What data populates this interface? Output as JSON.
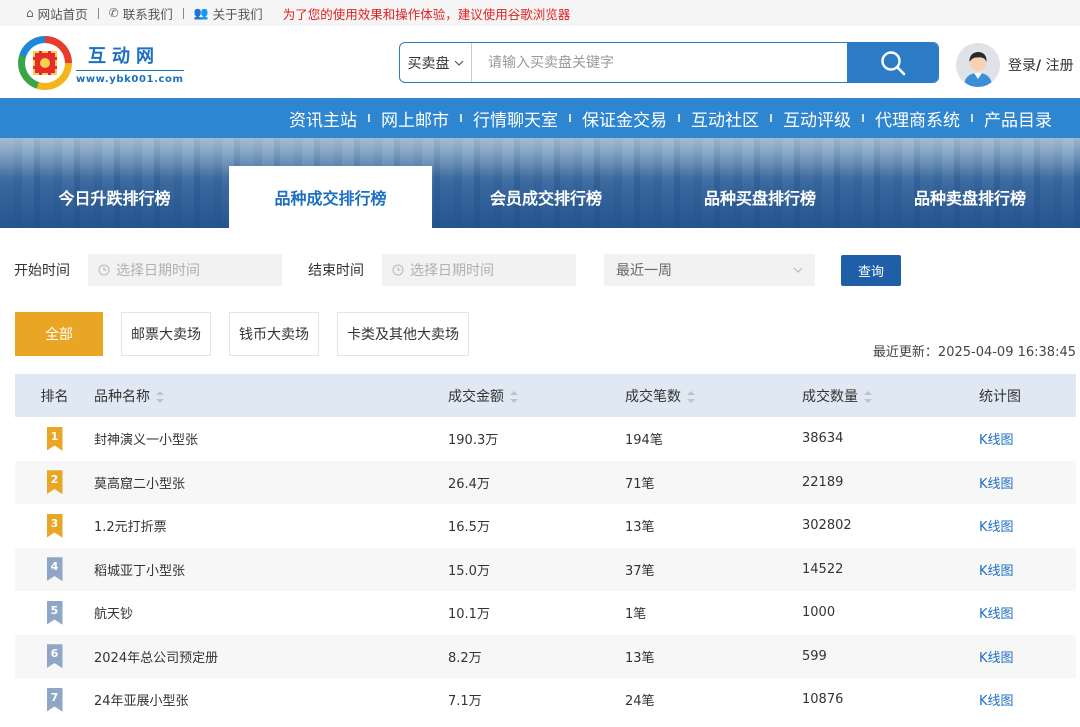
{
  "topbar": {
    "home": "网站首页",
    "contact": "联系我们",
    "about": "关于我们",
    "notice": "为了您的使用效果和操作体验，建议使用谷歌浏览器"
  },
  "logo": {
    "name": "互动网",
    "url": "www.ybk001.com"
  },
  "search": {
    "type": "买卖盘",
    "placeholder": "请输入买卖盘关键字"
  },
  "user": {
    "login": "登录",
    "separator": "/",
    "register": " 注册"
  },
  "nav": [
    "资讯主站",
    "网上邮市",
    "行情聊天室",
    "保证金交易",
    "互动社区",
    "互动评级",
    "代理商系统",
    "产品目录"
  ],
  "tabs": [
    "今日升跌排行榜",
    "品种成交排行榜",
    "会员成交排行榜",
    "品种买盘排行榜",
    "品种卖盘排行榜"
  ],
  "filter": {
    "start_label": "开始时间",
    "end_label": "结束时间",
    "date_placeholder": "选择日期时间",
    "range": "最近一周",
    "query": "查询"
  },
  "categories": [
    "全部",
    "邮票大卖场",
    "钱币大卖场",
    "卡类及其他大卖场"
  ],
  "updated": "最近更新：2025-04-09 16:38:45",
  "table": {
    "headers": [
      "排名",
      "品种名称",
      "成交金额",
      "成交笔数",
      "成交数量",
      "统计图"
    ],
    "rows": [
      {
        "rank": "1",
        "name": "封神演义一小型张",
        "amount": "190.3万",
        "count": "194笔",
        "qty": "38634",
        "chart": "K线图"
      },
      {
        "rank": "2",
        "name": "莫高窟二小型张",
        "amount": "26.4万",
        "count": "71笔",
        "qty": "22189",
        "chart": "K线图"
      },
      {
        "rank": "3",
        "name": "1.2元打折票",
        "amount": "16.5万",
        "count": "13笔",
        "qty": "302802",
        "chart": "K线图"
      },
      {
        "rank": "4",
        "name": "稻城亚丁小型张",
        "amount": "15.0万",
        "count": "37笔",
        "qty": "14522",
        "chart": "K线图"
      },
      {
        "rank": "5",
        "name": "航天钞",
        "amount": "10.1万",
        "count": "1笔",
        "qty": "1000",
        "chart": "K线图"
      },
      {
        "rank": "6",
        "name": "2024年总公司预定册",
        "amount": "8.2万",
        "count": "13笔",
        "qty": "599",
        "chart": "K线图"
      },
      {
        "rank": "7",
        "name": "24年亚展小型张",
        "amount": "7.1万",
        "count": "24笔",
        "qty": "10876",
        "chart": "K线图"
      }
    ]
  },
  "colors": {
    "primary": "#2d86cf",
    "accent": "#e8a624",
    "rank_top": "#e8a624",
    "rank_other": "#8fa7c4",
    "link": "#1e6ec4",
    "notice": "#e02020"
  }
}
